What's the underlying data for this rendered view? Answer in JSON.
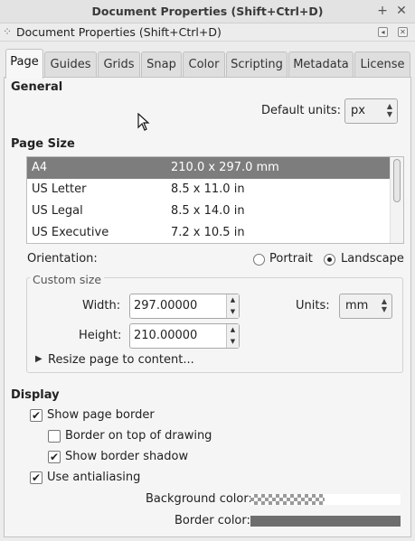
{
  "window": {
    "title": "Document Properties (Shift+Ctrl+D)",
    "buttons": {
      "add_label": "+",
      "close_label": "✕"
    }
  },
  "dock": {
    "grip_label": "⁘",
    "title": "Document Properties (Shift+Ctrl+D)",
    "iconify_label": "◂",
    "close_label": "✕"
  },
  "tabs": [
    {
      "label": "Page",
      "active": true
    },
    {
      "label": "Guides",
      "active": false
    },
    {
      "label": "Grids",
      "active": false
    },
    {
      "label": "Snap",
      "active": false
    },
    {
      "label": "Color",
      "active": false
    },
    {
      "label": "Scripting",
      "active": false
    },
    {
      "label": "Metadata",
      "active": false
    },
    {
      "label": "License",
      "active": false
    }
  ],
  "general": {
    "heading": "General",
    "default_units_label": "Default units:",
    "default_units_value": "px"
  },
  "page_size": {
    "heading": "Page Size",
    "rows": [
      {
        "name": "A4",
        "size": "210.0 x 297.0 mm",
        "selected": true
      },
      {
        "name": "US Letter",
        "size": "8.5 x 11.0 in",
        "selected": false
      },
      {
        "name": "US Legal",
        "size": "8.5 x 14.0 in",
        "selected": false
      },
      {
        "name": "US Executive",
        "size": "7.2 x 10.5 in",
        "selected": false
      }
    ],
    "orientation_label": "Orientation:",
    "portrait_label": "Portrait",
    "landscape_label": "Landscape",
    "orientation_selected": "Landscape"
  },
  "custom_size": {
    "legend": "Custom size",
    "width_label": "Width:",
    "width_value": "297.00000",
    "height_label": "Height:",
    "height_value": "210.00000",
    "units_label": "Units:",
    "units_value": "mm",
    "resize_label": "Resize page to content...",
    "expander_icon": "▶"
  },
  "display": {
    "heading": "Display",
    "show_page_border": {
      "label": "Show page border",
      "checked": true
    },
    "border_on_top": {
      "label": "Border on top of drawing",
      "checked": false
    },
    "show_border_shadow": {
      "label": "Show border shadow",
      "checked": true
    },
    "use_antialiasing": {
      "label": "Use antialiasing",
      "checked": true
    },
    "background_color_label": "Background color:",
    "border_color_label": "Border color:",
    "border_color": "#6e6e6e",
    "check_glyph": "✔",
    "spin_up": "▲",
    "spin_down": "▼"
  }
}
